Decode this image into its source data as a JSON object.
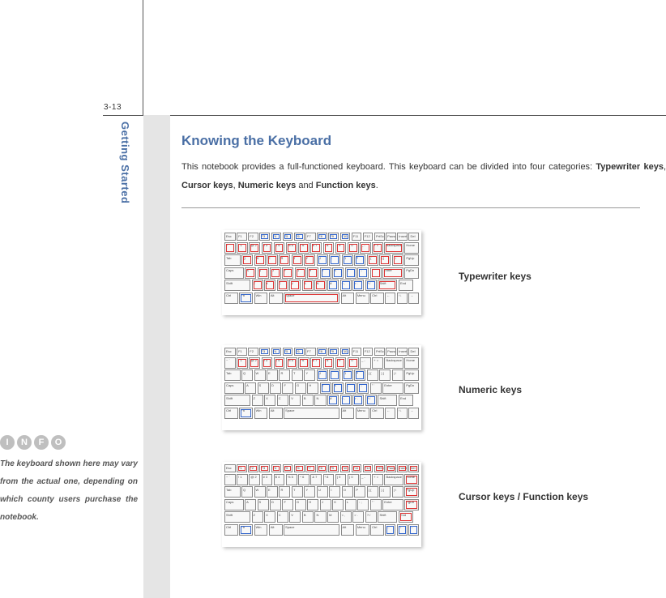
{
  "page_number": "3-13",
  "section_title": "Getting Started",
  "heading": "Knowing the Keyboard",
  "body": {
    "pre": "This notebook provides a full-functioned keyboard.  This keyboard can be divided into four categories: ",
    "b1": "Typewriter keys",
    "s1": ", ",
    "b2": "Cursor keys",
    "s2": ", ",
    "b3": "Numeric keys",
    "s3": " and ",
    "b4": "Function keys",
    "s4": "."
  },
  "labels": {
    "typewriter": "Typewriter keys",
    "numeric": "Numeric keys",
    "cursor_fn": "Cursor keys / Function keys"
  },
  "info_icons": [
    "I",
    "N",
    "F",
    "O"
  ],
  "info_note": "The keyboard shown here may vary from the actual one, depending on which county users purchase the notebook.",
  "keyboard": {
    "row_fn": [
      "Esc",
      "F1",
      "F2",
      "F3",
      "F4",
      "F5",
      "F6",
      "F7",
      "F8",
      "F9",
      "F10",
      "F11",
      "F12",
      "PrtScr",
      "Pause",
      "Insert",
      "Del"
    ],
    "row_num": [
      "~ `",
      "! 1",
      "@ 2",
      "# 3",
      "$ 4",
      "% 5",
      "^ 6",
      "& 7",
      "* 8",
      "( 9",
      ") 0",
      "_ -",
      "+ =",
      "Backspace",
      "Home"
    ],
    "row_q": [
      "Tab",
      "Q",
      "W",
      "E",
      "R",
      "T",
      "Y",
      "U",
      "I",
      "O",
      "P",
      "{ [",
      "} ]",
      "| \\",
      "PgUp"
    ],
    "row_a": [
      "Caps",
      "A",
      "S",
      "D",
      "F",
      "G",
      "H",
      "J",
      "K",
      "L",
      ": ;",
      "\" '",
      "Enter",
      "PgDn"
    ],
    "row_z": [
      "Shift",
      "Z",
      "X",
      "C",
      "V",
      "B",
      "N",
      "M",
      "< ,",
      "> .",
      "? /",
      "Shift",
      "End"
    ],
    "row_sp": [
      "Ctrl",
      "Fn",
      "Win",
      "Alt",
      "Space",
      "Alt",
      "Menu",
      "Ctrl",
      "←",
      "↑↓",
      "→"
    ]
  }
}
